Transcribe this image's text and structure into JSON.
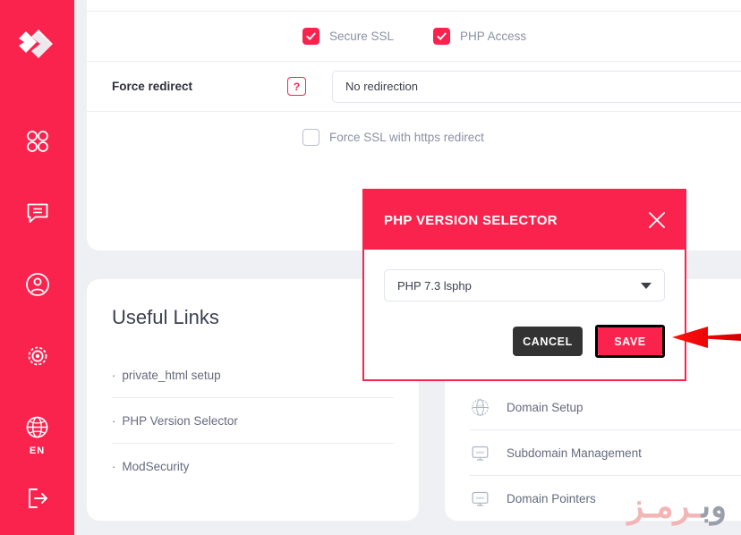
{
  "sidebar": {
    "brand_icon": "double-chevron-logo",
    "items": [
      {
        "icon": "grid-apps-icon",
        "name": "apps"
      },
      {
        "icon": "chat-bubble-icon",
        "name": "messages"
      },
      {
        "icon": "user-circle-icon",
        "name": "account"
      },
      {
        "icon": "gear-icon",
        "name": "settings"
      },
      {
        "icon": "globe-icon",
        "name": "language",
        "label": "EN"
      },
      {
        "icon": "logout-icon",
        "name": "logout"
      }
    ],
    "background": "#fa234d"
  },
  "settings": {
    "checkbox_row": [
      {
        "label": "Secure SSL",
        "checked": true
      },
      {
        "label": "PHP Access",
        "checked": true
      }
    ],
    "force_redirect": {
      "label": "Force redirect",
      "help": "?",
      "value": "No redirection"
    },
    "force_ssl": {
      "label": "Force SSL with https redirect",
      "checked": false
    }
  },
  "useful_links": {
    "title": "Useful Links",
    "items": [
      "private_html setup",
      "PHP Version Selector",
      "ModSecurity"
    ],
    "bullet": "·"
  },
  "shortcuts": {
    "items": [
      {
        "label": "Domain Setup",
        "icon": "globe-www-icon"
      },
      {
        "label": "Subdomain Management",
        "icon": "monitor-www-icon"
      },
      {
        "label": "Domain Pointers",
        "icon": "monitor-www-icon"
      }
    ]
  },
  "modal": {
    "title": "PHP VERSION SELECTOR",
    "close_icon": "close-icon",
    "select": {
      "value": "PHP 7.3 lsphp",
      "caret_icon": "chevron-down-icon"
    },
    "cancel_label": "CANCEL",
    "save_label": "SAVE",
    "accent": "#fa234d",
    "cancel_bg": "#333333"
  },
  "annotation": {
    "arrow": "red-arrow-pointing-left",
    "arrow_color": "#e80000",
    "highlight_color": "#fa234d"
  },
  "watermark": {
    "part_gray": "وب",
    "part_pink": "ـرمـز"
  }
}
